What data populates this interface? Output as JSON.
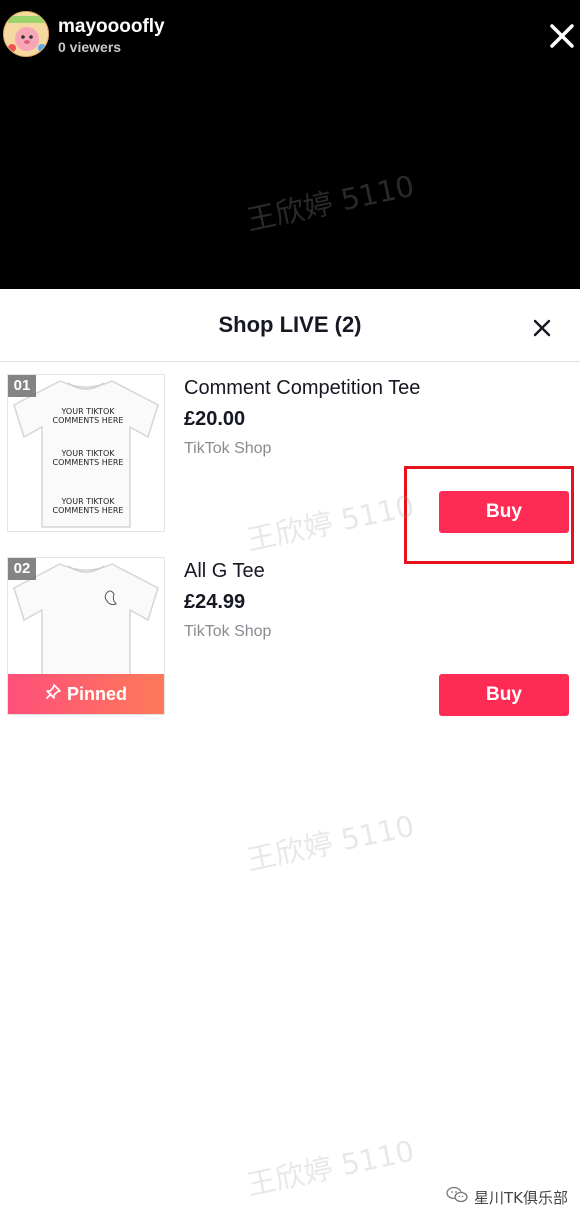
{
  "live": {
    "host_name": "mayoooofly",
    "viewers": "0 viewers",
    "close_icon": "close-icon"
  },
  "sheet": {
    "title": "Shop LIVE (2)",
    "close_icon": "close-icon"
  },
  "products": [
    {
      "index": "01",
      "name": "Comment Competition Tee",
      "price": "£20.00",
      "store": "TikTok Shop",
      "buy_label": "Buy",
      "shirt_text": "YOUR TIKTOK COMMENTS HERE"
    },
    {
      "index": "02",
      "name": "All G Tee",
      "price": "£24.99",
      "store": "TikTok Shop",
      "buy_label": "Buy",
      "pinned_label": "Pinned"
    }
  ],
  "watermark": {
    "text": "王欣婷 5110"
  },
  "footer": {
    "brand": "星川TK俱乐部"
  },
  "colors": {
    "accent": "#fe2c55",
    "highlight": "#e8101a"
  }
}
